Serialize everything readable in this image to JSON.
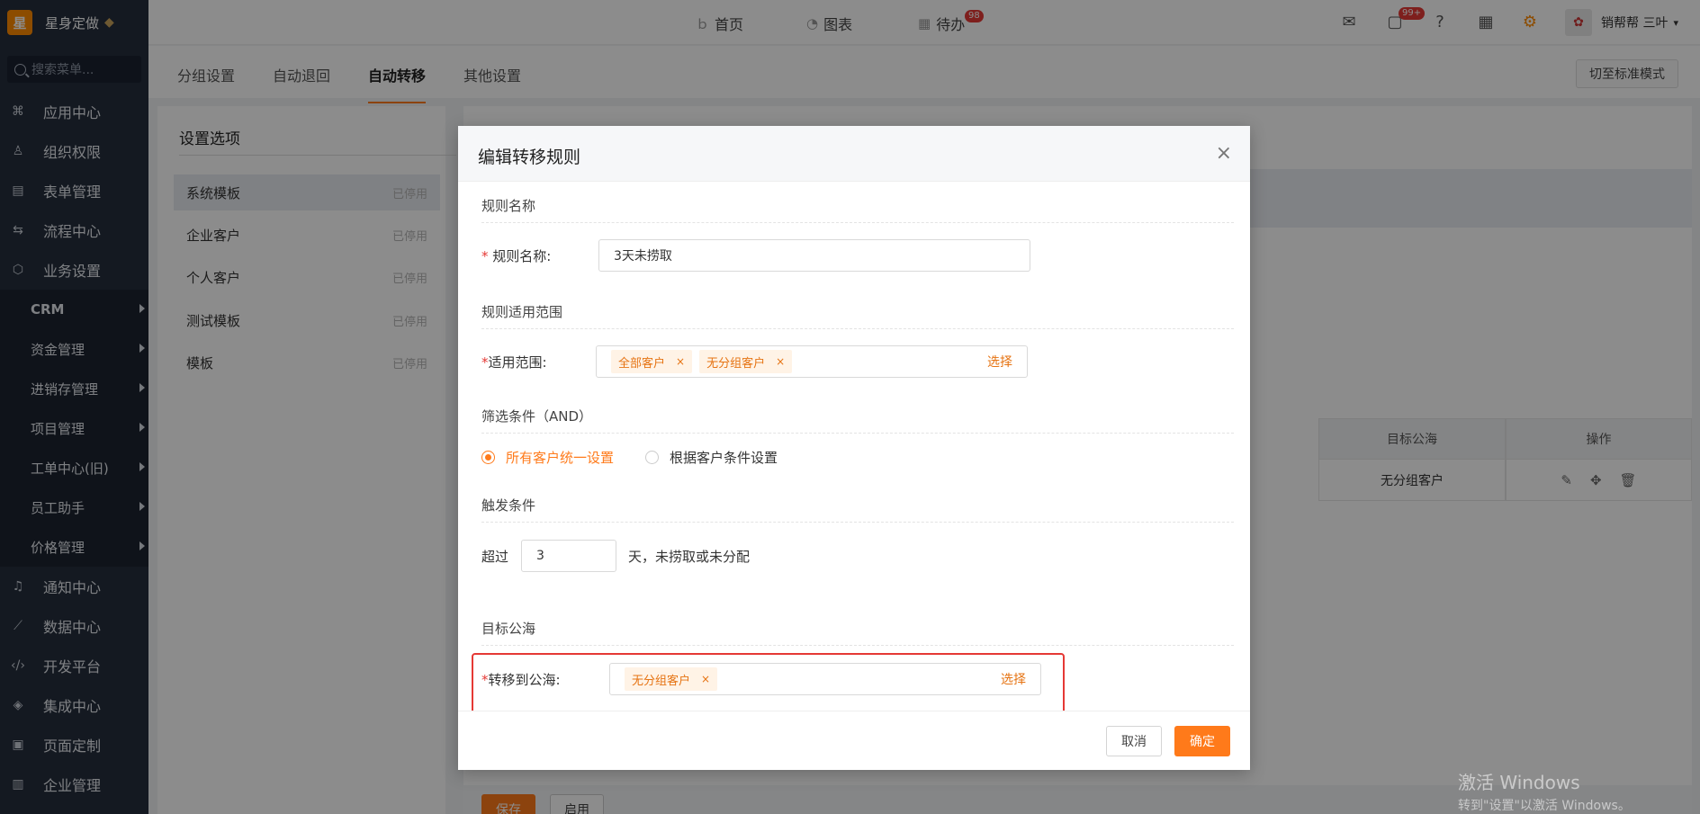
{
  "brand": {
    "logo_char": "星",
    "name": "星身定做"
  },
  "search": {
    "placeholder": "搜索菜单..."
  },
  "sidebar": {
    "items_top": [
      {
        "label": "应用中心",
        "icon": "apps-icon"
      },
      {
        "label": "组织权限",
        "icon": "user-icon"
      },
      {
        "label": "表单管理",
        "icon": "form-icon"
      },
      {
        "label": "流程中心",
        "icon": "flow-icon"
      },
      {
        "label": "业务设置",
        "icon": "cube-icon"
      }
    ],
    "sub_items": [
      "CRM",
      "资金管理",
      "进销存管理",
      "项目管理",
      "工单中心(旧)",
      "员工助手",
      "价格管理"
    ],
    "items_bottom": [
      {
        "label": "通知中心",
        "icon": "bell-icon"
      },
      {
        "label": "数据中心",
        "icon": "chart-icon"
      },
      {
        "label": "开发平台",
        "icon": "code-icon"
      },
      {
        "label": "集成中心",
        "icon": "layers-icon"
      },
      {
        "label": "页面定制",
        "icon": "layout-icon"
      },
      {
        "label": "企业管理",
        "icon": "building-icon"
      }
    ]
  },
  "topbar": {
    "nav": [
      {
        "label": "首页",
        "icon": "home-icon"
      },
      {
        "label": "图表",
        "icon": "pie-icon"
      },
      {
        "label": "待办",
        "icon": "calendar-icon",
        "badge": "98"
      }
    ],
    "chat_badge": "99+",
    "user_name": "销帮帮 三叶"
  },
  "tabs": {
    "items": [
      "分组设置",
      "自动退回",
      "自动转移",
      "其他设置"
    ],
    "active_index": 2,
    "switch_mode": "切至标准模式"
  },
  "settings": {
    "title": "设置选项",
    "items": [
      {
        "label": "系统模板",
        "status": "已停用"
      },
      {
        "label": "企业客户",
        "status": "已停用"
      },
      {
        "label": "个人客户",
        "status": "已停用"
      },
      {
        "label": "测试模板",
        "status": "已停用"
      },
      {
        "label": "模板",
        "status": "已停用"
      }
    ]
  },
  "table": {
    "headers": [
      "目标公海",
      "操作"
    ],
    "row": {
      "target": "无分组客户"
    }
  },
  "bottom": {
    "save": "保存",
    "enable": "启用"
  },
  "modal": {
    "title": "编辑转移规则",
    "close": "×",
    "sec_name": "规则名称",
    "name_label": "规则名称:",
    "name_value": "3天未捞取",
    "sec_scope": "规则适用范围",
    "scope_label": "适用范围:",
    "scope_tags": [
      "全部客户",
      "无分组客户"
    ],
    "select_text": "选择",
    "sec_filter": "筛选条件（AND）",
    "radio_all": "所有客户统一设置",
    "radio_cond": "根据客户条件设置",
    "sec_trigger": "触发条件",
    "trigger_pre": "超过",
    "trigger_value": "3",
    "trigger_post": "天，未捞取或未分配",
    "sec_target": "目标公海",
    "target_label": "转移到公海:",
    "target_tags": [
      "无分组客户"
    ],
    "cancel": "取消",
    "ok": "确定"
  },
  "watermark": {
    "line1": "激活 Windows",
    "line2": "转到\"设置\"以激活 Windows。"
  },
  "colors": {
    "accent": "#ff7a1a",
    "sidebar_bg": "#252e3c",
    "highlight": "#e53935"
  }
}
